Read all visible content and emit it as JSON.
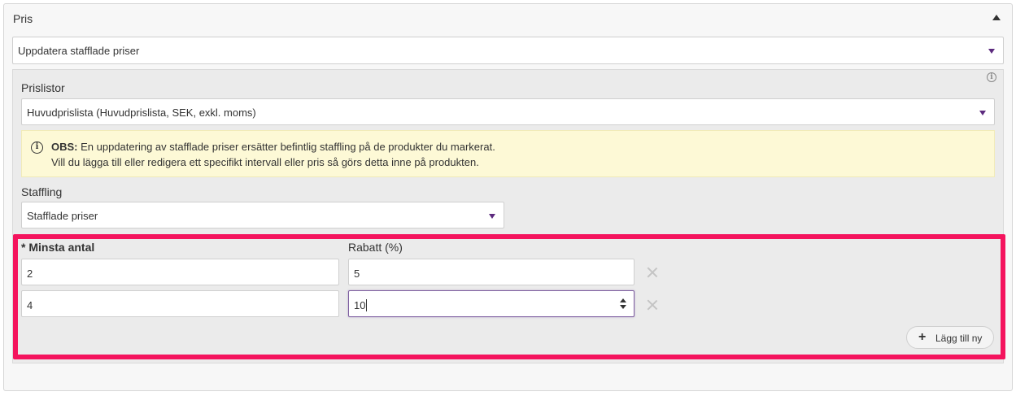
{
  "panel": {
    "title": "Pris"
  },
  "action_select": {
    "value": "Uppdatera stafflade priser"
  },
  "pricelists": {
    "label": "Prislistor",
    "value": "Huvudprislista (Huvudprislista, SEK, exkl. moms)"
  },
  "notice": {
    "bold": "OBS:",
    "line1": " En uppdatering av stafflade priser ersätter befintlig staffling på de produkter du markerat.",
    "line2": "Vill du lägga till eller redigera ett specifikt intervall eller pris så görs detta inne på produkten."
  },
  "staffling": {
    "label": "Staffling",
    "value": "Stafflade priser"
  },
  "tiers": {
    "min_qty_label": "* Minsta antal",
    "discount_label": "Rabatt (%)",
    "rows": [
      {
        "min_qty": "2",
        "discount": "5"
      },
      {
        "min_qty": "4",
        "discount": "10"
      }
    ],
    "add_label": "Lägg till ny"
  },
  "colors": {
    "highlight": "#f4135d",
    "caret": "#5c2a7e",
    "notice_bg": "#fdf9d6"
  }
}
